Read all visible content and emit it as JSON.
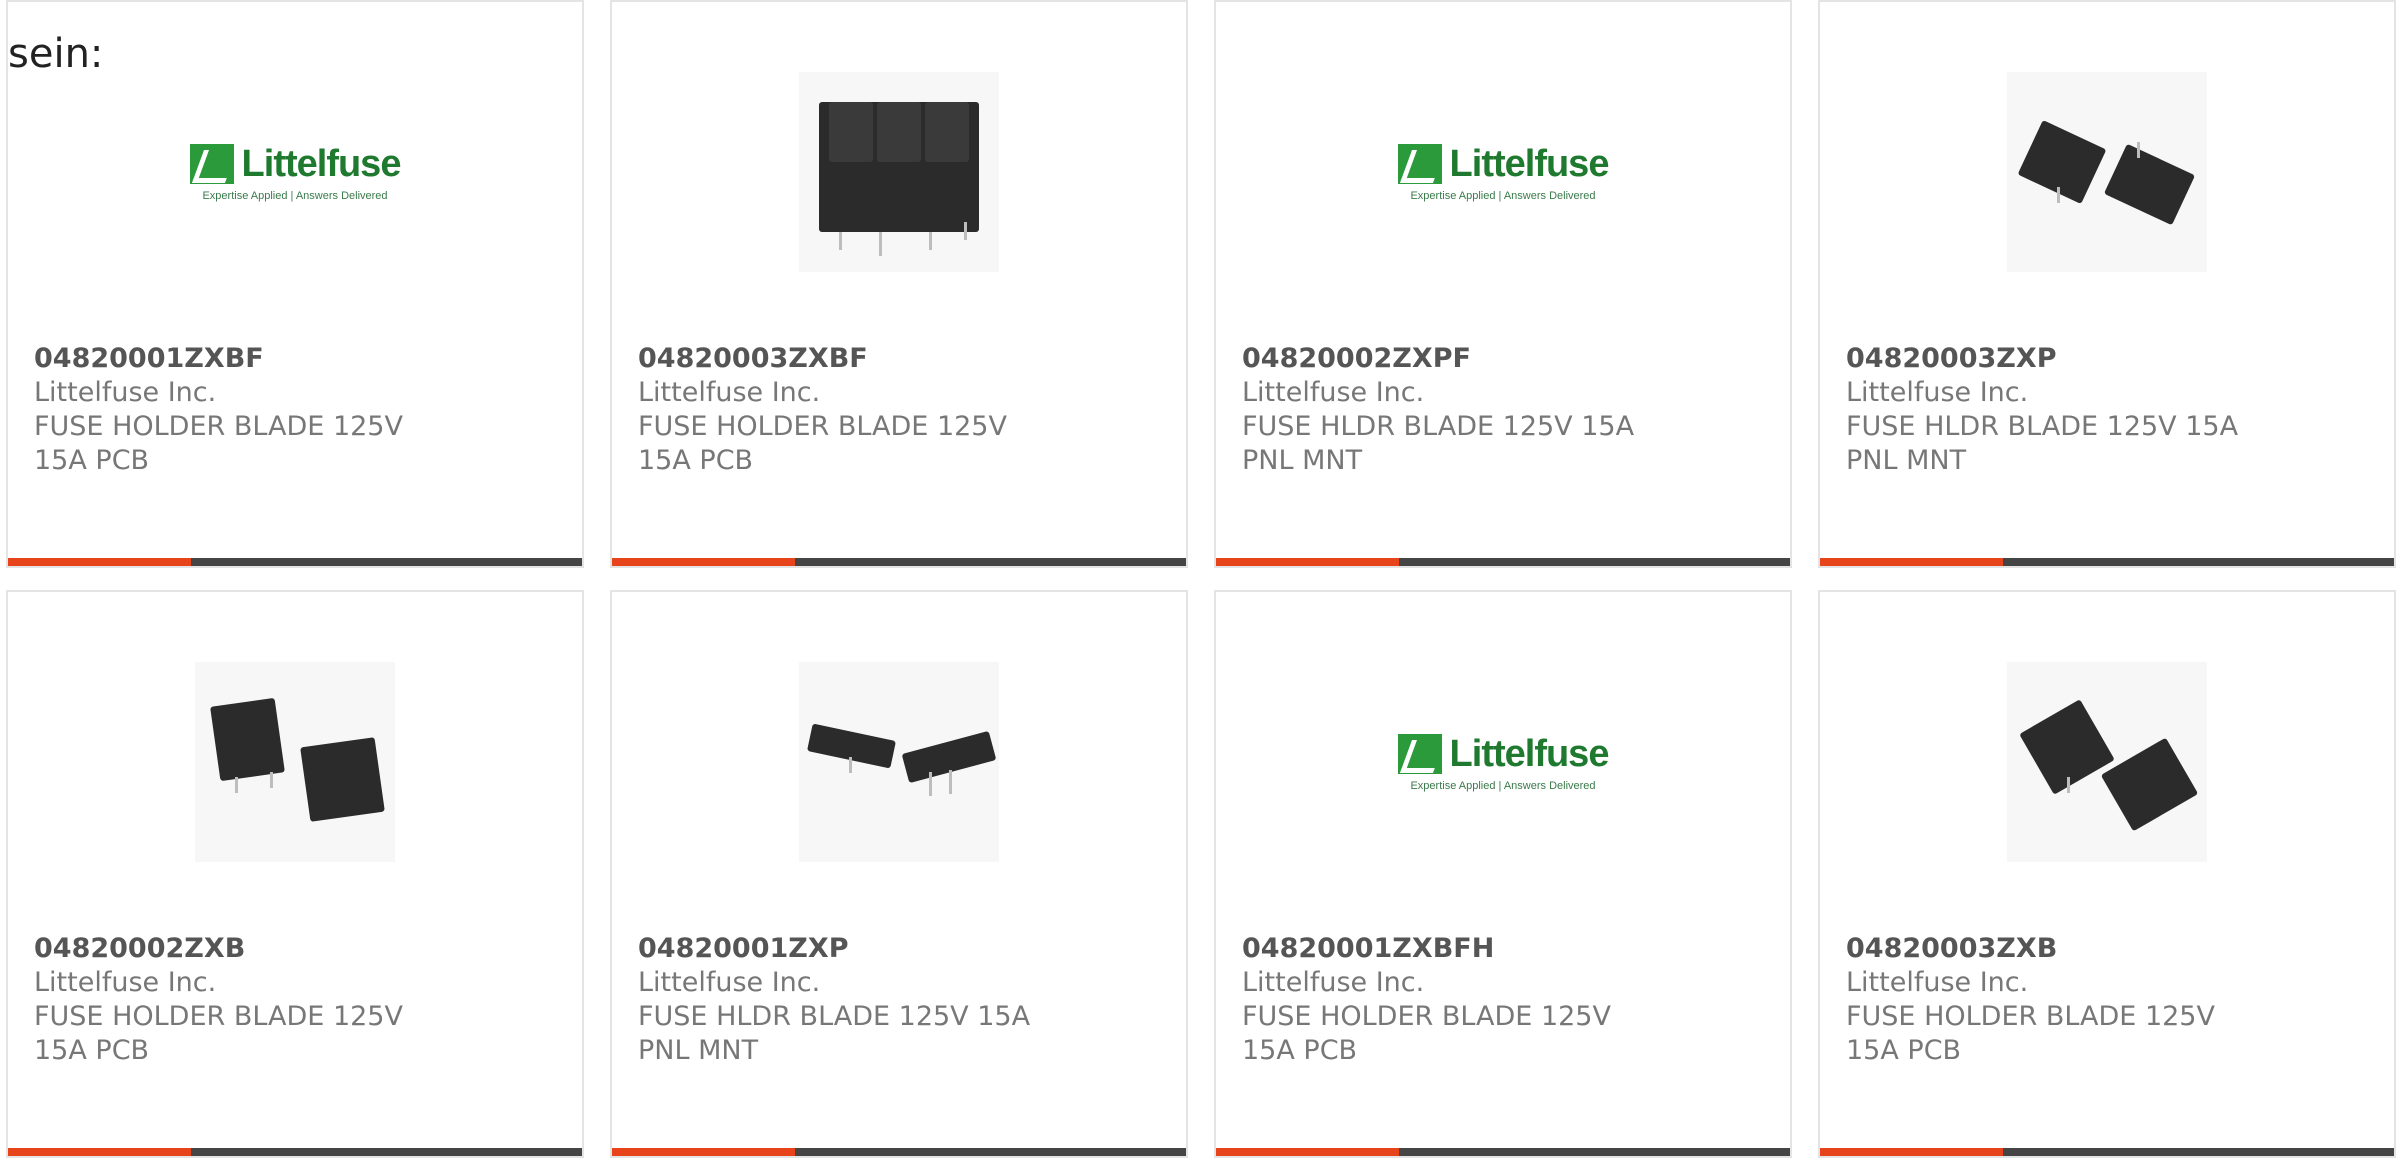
{
  "intro_text": "sein:",
  "colors": {
    "accent": "#e8441c",
    "bar": "#454545",
    "border": "#e4e4e4"
  },
  "logo": {
    "word": "Littelfuse",
    "tagline": "Expertise Applied | Answers Delivered"
  },
  "products": [
    {
      "part_number": "04820001ZXBF",
      "manufacturer": "Littelfuse Inc.",
      "description": "FUSE HOLDER BLADE 125V 15A PCB",
      "image": "littelfuse-logo"
    },
    {
      "part_number": "04820003ZXBF",
      "manufacturer": "Littelfuse Inc.",
      "description": "FUSE HOLDER BLADE 125V 15A PCB",
      "image": "fuse-holder-block-photo"
    },
    {
      "part_number": "04820002ZXPF",
      "manufacturer": "Littelfuse Inc.",
      "description": "FUSE HLDR BLADE 125V 15A PNL MNT",
      "image": "littelfuse-logo"
    },
    {
      "part_number": "04820003ZXP",
      "manufacturer": "Littelfuse Inc.",
      "description": "FUSE HLDR BLADE 125V 15A PNL MNT",
      "image": "fuse-holder-pair-photo"
    },
    {
      "part_number": "04820002ZXB",
      "manufacturer": "Littelfuse Inc.",
      "description": "FUSE HOLDER BLADE 125V 15A PCB",
      "image": "fuse-holder-pair-photo"
    },
    {
      "part_number": "04820001ZXP",
      "manufacturer": "Littelfuse Inc.",
      "description": "FUSE HLDR BLADE 125V 15A PNL MNT",
      "image": "fuse-holder-flat-photo"
    },
    {
      "part_number": "04820001ZXBFH",
      "manufacturer": "Littelfuse Inc.",
      "description": "FUSE HOLDER BLADE 125V 15A PCB",
      "image": "littelfuse-logo"
    },
    {
      "part_number": "04820003ZXB",
      "manufacturer": "Littelfuse Inc.",
      "description": "FUSE HOLDER BLADE 125V 15A PCB",
      "image": "fuse-holder-pair-photo"
    }
  ]
}
